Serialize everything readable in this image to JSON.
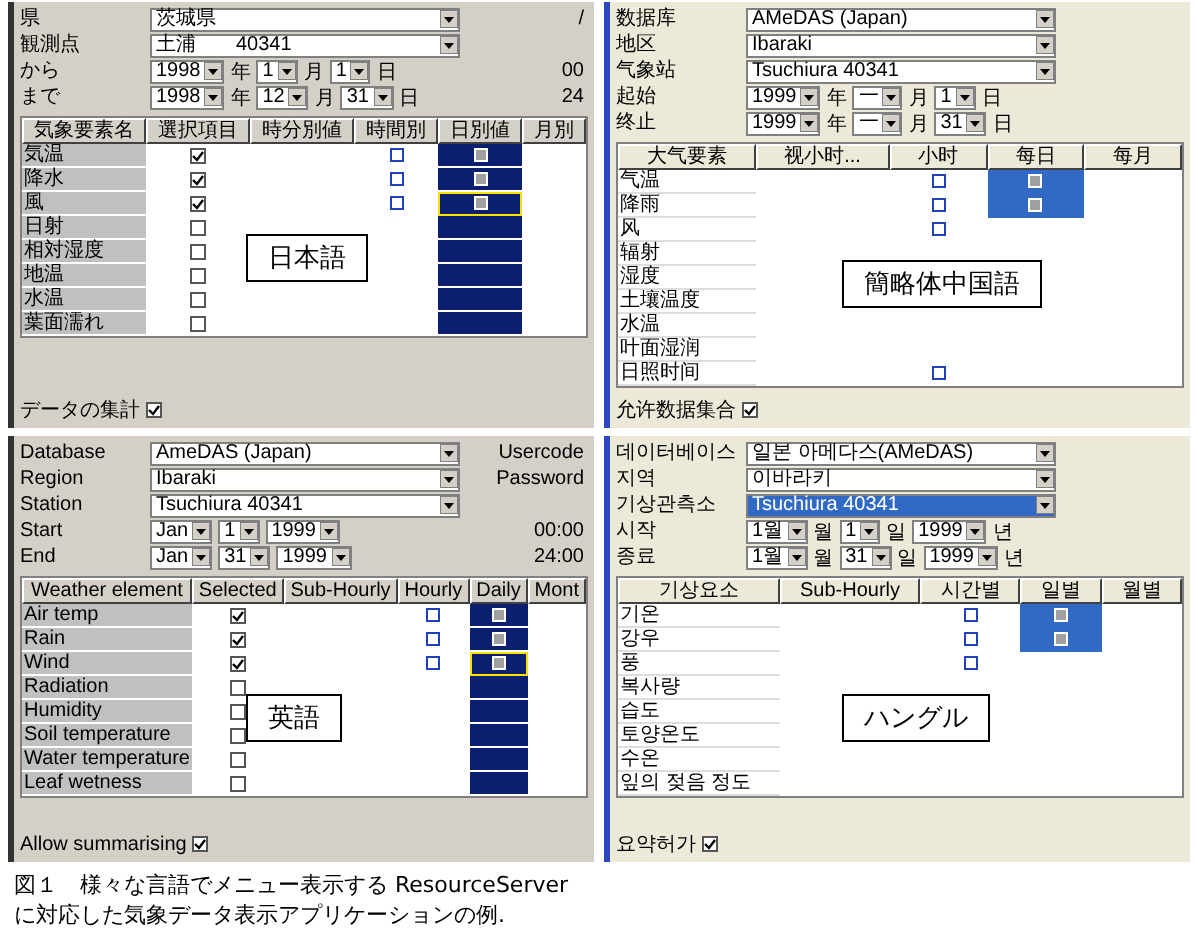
{
  "panels": [
    {
      "language_label": "日本語",
      "fields": [
        {
          "label": "県",
          "value": "茨城県",
          "side": "/"
        },
        {
          "label": "観測点",
          "value": "土浦　　40341"
        }
      ],
      "dates": [
        {
          "label": "から",
          "parts": [
            {
              "kind": "select",
              "value": "1998"
            },
            {
              "kind": "text",
              "value": "年"
            },
            {
              "kind": "select",
              "value": "1"
            },
            {
              "kind": "text",
              "value": "月"
            },
            {
              "kind": "select",
              "value": "1"
            },
            {
              "kind": "text",
              "value": "日"
            }
          ],
          "side": "00"
        },
        {
          "label": "まで",
          "parts": [
            {
              "kind": "select",
              "value": "1998"
            },
            {
              "kind": "text",
              "value": "年"
            },
            {
              "kind": "select",
              "value": "12"
            },
            {
              "kind": "text",
              "value": "月"
            },
            {
              "kind": "select",
              "value": "31"
            },
            {
              "kind": "text",
              "value": "日"
            }
          ],
          "side": "24"
        }
      ],
      "columns": [
        {
          "label": "気象要素名",
          "kind": "name"
        },
        {
          "label": "選択項目",
          "kind": "select"
        },
        {
          "label": "時分別値",
          "kind": "other"
        },
        {
          "label": "時間別",
          "kind": "hourly"
        },
        {
          "label": "日別値",
          "kind": "daily"
        },
        {
          "label": "月別",
          "kind": "other"
        }
      ],
      "rows": [
        {
          "label": "気温",
          "checked": true,
          "hourly": true,
          "daily": true,
          "focused": false
        },
        {
          "label": "降水",
          "checked": true,
          "hourly": true,
          "daily": true,
          "focused": false
        },
        {
          "label": "風",
          "checked": true,
          "hourly": true,
          "daily": true,
          "focused": true
        },
        {
          "label": "日射",
          "checked": false,
          "hourly": false,
          "daily": false,
          "focused": false
        },
        {
          "label": "相対湿度",
          "checked": false,
          "hourly": false,
          "daily": false,
          "focused": false
        },
        {
          "label": "地温",
          "checked": false,
          "hourly": false,
          "daily": false,
          "focused": false
        },
        {
          "label": "水温",
          "checked": false,
          "hourly": false,
          "daily": false,
          "focused": false
        },
        {
          "label": "葉面濡れ",
          "checked": false,
          "hourly": false,
          "daily": false,
          "focused": false
        }
      ],
      "summary": {
        "label": "データの集計",
        "checked": true
      }
    },
    {
      "language_label": "簡略体中国語",
      "fields": [
        {
          "label": "数据库",
          "value": "AMeDAS (Japan)"
        },
        {
          "label": "地区",
          "value": "Ibaraki"
        },
        {
          "label": "气象站",
          "value": "Tsuchiura 40341"
        }
      ],
      "dates": [
        {
          "label": "起始",
          "parts": [
            {
              "kind": "select",
              "value": "1999"
            },
            {
              "kind": "text",
              "value": "年"
            },
            {
              "kind": "select",
              "value": "一"
            },
            {
              "kind": "text",
              "value": "月"
            },
            {
              "kind": "select",
              "value": "1"
            },
            {
              "kind": "text",
              "value": "日"
            }
          ]
        },
        {
          "label": "终止",
          "parts": [
            {
              "kind": "select",
              "value": "1999"
            },
            {
              "kind": "text",
              "value": "年"
            },
            {
              "kind": "select",
              "value": "一"
            },
            {
              "kind": "text",
              "value": "月"
            },
            {
              "kind": "select",
              "value": "31"
            },
            {
              "kind": "text",
              "value": "日"
            }
          ]
        }
      ],
      "columns": [
        {
          "label": "大气要素",
          "kind": "name"
        },
        {
          "label": "视小时...",
          "kind": "other"
        },
        {
          "label": "小时",
          "kind": "hourly"
        },
        {
          "label": "每日",
          "kind": "daily"
        },
        {
          "label": "每月",
          "kind": "other"
        }
      ],
      "rows": [
        {
          "label": "气温",
          "hourly": true,
          "daily": true
        },
        {
          "label": "降雨",
          "hourly": true,
          "daily": true
        },
        {
          "label": "风",
          "hourly": true,
          "daily": false
        },
        {
          "label": "辐射",
          "hourly": false,
          "daily": false
        },
        {
          "label": "湿度"
        },
        {
          "label": "土壤温度"
        },
        {
          "label": "水温"
        },
        {
          "label": "叶面湿润",
          "hourly": false,
          "daily": false
        },
        {
          "label": "日照时间",
          "hourly": true,
          "daily": false
        }
      ],
      "summary": {
        "label": "允许数据集合",
        "checked": true
      }
    },
    {
      "language_label": "英語",
      "fields": [
        {
          "label": "Database",
          "value": "AmeDAS (Japan)",
          "side": "Usercode"
        },
        {
          "label": "Region",
          "value": "Ibaraki",
          "side": "Password"
        },
        {
          "label": "Station",
          "value": "Tsuchiura 40341"
        }
      ],
      "dates": [
        {
          "label": "Start",
          "parts": [
            {
              "kind": "select",
              "value": "Jan"
            },
            {
              "kind": "select",
              "value": "1"
            },
            {
              "kind": "select",
              "value": "1999"
            }
          ],
          "side": "00:00"
        },
        {
          "label": "End",
          "parts": [
            {
              "kind": "select",
              "value": "Jan"
            },
            {
              "kind": "select",
              "value": "31"
            },
            {
              "kind": "select",
              "value": "1999"
            }
          ],
          "side": "24:00"
        }
      ],
      "columns": [
        {
          "label": "Weather element",
          "kind": "name"
        },
        {
          "label": "Selected",
          "kind": "select"
        },
        {
          "label": "Sub-Hourly",
          "kind": "other"
        },
        {
          "label": "Hourly",
          "kind": "hourly"
        },
        {
          "label": "Daily",
          "kind": "daily"
        },
        {
          "label": "Mont",
          "kind": "other"
        }
      ],
      "rows": [
        {
          "label": "Air temp",
          "checked": true,
          "hourly": true,
          "daily": true,
          "focused": false
        },
        {
          "label": "Rain",
          "checked": true,
          "hourly": true,
          "daily": true,
          "focused": false
        },
        {
          "label": "Wind",
          "checked": true,
          "hourly": true,
          "daily": true,
          "focused": true
        },
        {
          "label": "Radiation",
          "checked": false,
          "hourly": false,
          "daily": false,
          "focused": false
        },
        {
          "label": "Humidity",
          "checked": false,
          "hourly": false,
          "daily": false,
          "focused": false
        },
        {
          "label": "Soil temperature",
          "checked": false,
          "hourly": false,
          "daily": false,
          "focused": false
        },
        {
          "label": "Water temperature",
          "checked": false,
          "hourly": false,
          "daily": false,
          "focused": false
        },
        {
          "label": "Leaf wetness",
          "checked": false,
          "hourly": false,
          "daily": false,
          "focused": false
        }
      ],
      "summary": {
        "label": "Allow summarising",
        "checked": true
      }
    },
    {
      "language_label": "ハングル",
      "fields": [
        {
          "label": "데이터베이스",
          "value": "일본 아메다스(AMeDAS)"
        },
        {
          "label": "지역",
          "value": "이바라키"
        },
        {
          "label": "기상관측소",
          "value": "Tsuchiura 40341",
          "selected": true
        }
      ],
      "dates": [
        {
          "label": "시작",
          "parts": [
            {
              "kind": "select",
              "value": "1월"
            },
            {
              "kind": "text",
              "value": "월"
            },
            {
              "kind": "select",
              "value": "1"
            },
            {
              "kind": "text",
              "value": "일"
            },
            {
              "kind": "select",
              "value": "1999"
            },
            {
              "kind": "text",
              "value": "년"
            }
          ]
        },
        {
          "label": "종료",
          "parts": [
            {
              "kind": "select",
              "value": "1월"
            },
            {
              "kind": "text",
              "value": "월"
            },
            {
              "kind": "select",
              "value": "31"
            },
            {
              "kind": "text",
              "value": "일"
            },
            {
              "kind": "select",
              "value": "1999"
            },
            {
              "kind": "text",
              "value": "년"
            }
          ]
        }
      ],
      "columns": [
        {
          "label": "기상요소",
          "kind": "name"
        },
        {
          "label": "Sub-Hourly",
          "kind": "other"
        },
        {
          "label": "시간별",
          "kind": "hourly"
        },
        {
          "label": "일별",
          "kind": "daily"
        },
        {
          "label": "월별",
          "kind": "other"
        }
      ],
      "rows": [
        {
          "label": "기온",
          "hourly": true,
          "daily": true
        },
        {
          "label": "강우",
          "hourly": true,
          "daily": true
        },
        {
          "label": "풍",
          "hourly": true,
          "daily": false
        },
        {
          "label": "복사량",
          "hourly": false,
          "daily": false
        },
        {
          "label": "습도"
        },
        {
          "label": "토양온도"
        },
        {
          "label": "수온"
        },
        {
          "label": "잎의 젖음 정도",
          "hourly": false,
          "daily": false
        }
      ],
      "summary": {
        "label": "요약허가",
        "checked": true
      }
    }
  ],
  "caption_lines": [
    "図１　様々な言語でメニュー表示する ResourceServer",
    "に対応した気象データ表示アプリケーションの例."
  ]
}
